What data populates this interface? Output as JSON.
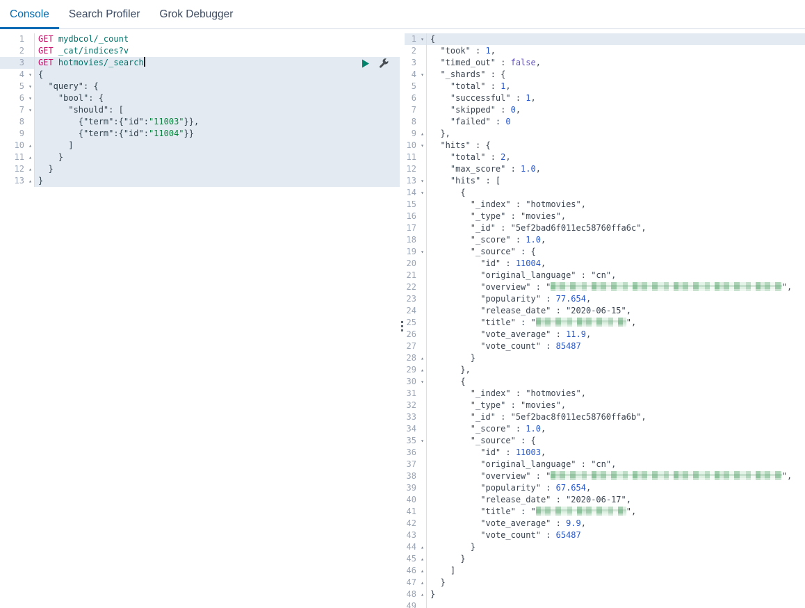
{
  "tabs": [
    {
      "label": "Console",
      "active": true
    },
    {
      "label": "Search Profiler",
      "active": false
    },
    {
      "label": "Grok Debugger",
      "active": false
    }
  ],
  "colors": {
    "accent_blue": "#006bb4",
    "method_pink": "#c80a68",
    "url_teal": "#00756b",
    "string_green": "#0a843f",
    "number_blue": "#2456c9",
    "boolean_violet": "#6554c0",
    "active_line_bg": "#e4eaf2",
    "play_icon_green": "#00826b"
  },
  "left_editor": {
    "lines": [
      {
        "n": 1,
        "f": "",
        "s": [
          [
            "m",
            "GET "
          ],
          [
            "u",
            "mydbcol/_count"
          ]
        ]
      },
      {
        "n": 2,
        "f": "",
        "s": [
          [
            "m",
            "GET "
          ],
          [
            "u",
            "_cat/indices?v"
          ]
        ]
      },
      {
        "n": 3,
        "f": "",
        "a": true,
        "icons": true,
        "s": [
          [
            "m",
            "GET "
          ],
          [
            "u",
            "hotmovies/_search"
          ],
          [
            "cur",
            ""
          ]
        ]
      },
      {
        "n": 4,
        "f": "o",
        "h": true,
        "s": [
          [
            "k",
            "{"
          ]
        ]
      },
      {
        "n": 5,
        "f": "o",
        "h": true,
        "s": [
          [
            "k",
            "  \"query\": {"
          ]
        ]
      },
      {
        "n": 6,
        "f": "o",
        "h": true,
        "s": [
          [
            "k",
            "    \"bool\": {"
          ]
        ]
      },
      {
        "n": 7,
        "f": "o",
        "h": true,
        "s": [
          [
            "k",
            "      \"should\": ["
          ]
        ]
      },
      {
        "n": 8,
        "f": "",
        "h": true,
        "s": [
          [
            "k",
            "        {\"term\":{\"id\":"
          ],
          [
            "s",
            "\"11003\""
          ],
          [
            "k",
            "}},"
          ]
        ]
      },
      {
        "n": 9,
        "f": "",
        "h": true,
        "s": [
          [
            "k",
            "        {\"term\":{\"id\":"
          ],
          [
            "s",
            "\"11004\""
          ],
          [
            "k",
            "}}"
          ]
        ]
      },
      {
        "n": 10,
        "f": "c",
        "h": true,
        "s": [
          [
            "k",
            "      ]"
          ]
        ]
      },
      {
        "n": 11,
        "f": "c",
        "h": true,
        "s": [
          [
            "k",
            "    }"
          ]
        ]
      },
      {
        "n": 12,
        "f": "c",
        "h": true,
        "s": [
          [
            "k",
            "  }"
          ]
        ]
      },
      {
        "n": 13,
        "f": "c",
        "h": true,
        "s": [
          [
            "k",
            "}"
          ]
        ]
      }
    ]
  },
  "right_editor": {
    "lines": [
      {
        "n": 1,
        "f": "o",
        "a": true,
        "s": [
          [
            "t",
            "{"
          ]
        ]
      },
      {
        "n": 2,
        "f": "",
        "s": [
          [
            "t",
            "  \"took\" : "
          ],
          [
            "n",
            "1"
          ],
          [
            "t",
            ","
          ]
        ]
      },
      {
        "n": 3,
        "f": "",
        "s": [
          [
            "t",
            "  \"timed_out\" : "
          ],
          [
            "b",
            "false"
          ],
          [
            "t",
            ","
          ]
        ]
      },
      {
        "n": 4,
        "f": "o",
        "s": [
          [
            "t",
            "  \"_shards\" : {"
          ]
        ]
      },
      {
        "n": 5,
        "f": "",
        "s": [
          [
            "t",
            "    \"total\" : "
          ],
          [
            "n",
            "1"
          ],
          [
            "t",
            ","
          ]
        ]
      },
      {
        "n": 6,
        "f": "",
        "s": [
          [
            "t",
            "    \"successful\" : "
          ],
          [
            "n",
            "1"
          ],
          [
            "t",
            ","
          ]
        ]
      },
      {
        "n": 7,
        "f": "",
        "s": [
          [
            "t",
            "    \"skipped\" : "
          ],
          [
            "n",
            "0"
          ],
          [
            "t",
            ","
          ]
        ]
      },
      {
        "n": 8,
        "f": "",
        "s": [
          [
            "t",
            "    \"failed\" : "
          ],
          [
            "n",
            "0"
          ]
        ]
      },
      {
        "n": 9,
        "f": "c",
        "s": [
          [
            "t",
            "  },"
          ]
        ]
      },
      {
        "n": 10,
        "f": "o",
        "s": [
          [
            "t",
            "  \"hits\" : {"
          ]
        ]
      },
      {
        "n": 11,
        "f": "",
        "s": [
          [
            "t",
            "    \"total\" : "
          ],
          [
            "n",
            "2"
          ],
          [
            "t",
            ","
          ]
        ]
      },
      {
        "n": 12,
        "f": "",
        "s": [
          [
            "t",
            "    \"max_score\" : "
          ],
          [
            "n",
            "1.0"
          ],
          [
            "t",
            ","
          ]
        ]
      },
      {
        "n": 13,
        "f": "o",
        "s": [
          [
            "t",
            "    \"hits\" : ["
          ]
        ]
      },
      {
        "n": 14,
        "f": "o",
        "s": [
          [
            "t",
            "      {"
          ]
        ]
      },
      {
        "n": 15,
        "f": "",
        "s": [
          [
            "t",
            "        \"_index\" : \"hotmovies\","
          ]
        ]
      },
      {
        "n": 16,
        "f": "",
        "s": [
          [
            "t",
            "        \"_type\" : \"movies\","
          ]
        ]
      },
      {
        "n": 17,
        "f": "",
        "s": [
          [
            "t",
            "        \"_id\" : \"5ef2bad6f011ec58760ffa6c\","
          ]
        ]
      },
      {
        "n": 18,
        "f": "",
        "s": [
          [
            "t",
            "        \"_score\" : "
          ],
          [
            "n",
            "1.0"
          ],
          [
            "t",
            ","
          ]
        ]
      },
      {
        "n": 19,
        "f": "o",
        "s": [
          [
            "t",
            "        \"_source\" : {"
          ]
        ]
      },
      {
        "n": 20,
        "f": "",
        "s": [
          [
            "t",
            "          \"id\" : "
          ],
          [
            "n",
            "11004"
          ],
          [
            "t",
            ","
          ]
        ]
      },
      {
        "n": 21,
        "f": "",
        "s": [
          [
            "t",
            "          \"original_language\" : \"cn\","
          ]
        ]
      },
      {
        "n": 22,
        "f": "",
        "s": [
          [
            "t",
            "          \"overview\" : \""
          ],
          [
            "c",
            "46"
          ],
          [
            "t",
            "\","
          ]
        ]
      },
      {
        "n": 23,
        "f": "",
        "s": [
          [
            "t",
            "          \"popularity\" : "
          ],
          [
            "n",
            "77.654"
          ],
          [
            "t",
            ","
          ]
        ]
      },
      {
        "n": 24,
        "f": "",
        "s": [
          [
            "t",
            "          \"release_date\" : \"2020-06-15\","
          ]
        ]
      },
      {
        "n": 25,
        "f": "",
        "s": [
          [
            "t",
            "          \"title\" : \""
          ],
          [
            "c",
            "18"
          ],
          [
            "t",
            "\","
          ]
        ]
      },
      {
        "n": 26,
        "f": "",
        "s": [
          [
            "t",
            "          \"vote_average\" : "
          ],
          [
            "n",
            "11.9"
          ],
          [
            "t",
            ","
          ]
        ]
      },
      {
        "n": 27,
        "f": "",
        "s": [
          [
            "t",
            "          \"vote_count\" : "
          ],
          [
            "n",
            "85487"
          ]
        ]
      },
      {
        "n": 28,
        "f": "c",
        "s": [
          [
            "t",
            "        }"
          ]
        ]
      },
      {
        "n": 29,
        "f": "c",
        "s": [
          [
            "t",
            "      },"
          ]
        ]
      },
      {
        "n": 30,
        "f": "o",
        "s": [
          [
            "t",
            "      {"
          ]
        ]
      },
      {
        "n": 31,
        "f": "",
        "s": [
          [
            "t",
            "        \"_index\" : \"hotmovies\","
          ]
        ]
      },
      {
        "n": 32,
        "f": "",
        "s": [
          [
            "t",
            "        \"_type\" : \"movies\","
          ]
        ]
      },
      {
        "n": 33,
        "f": "",
        "s": [
          [
            "t",
            "        \"_id\" : \"5ef2bac8f011ec58760ffa6b\","
          ]
        ]
      },
      {
        "n": 34,
        "f": "",
        "s": [
          [
            "t",
            "        \"_score\" : "
          ],
          [
            "n",
            "1.0"
          ],
          [
            "t",
            ","
          ]
        ]
      },
      {
        "n": 35,
        "f": "o",
        "s": [
          [
            "t",
            "        \"_source\" : {"
          ]
        ]
      },
      {
        "n": 36,
        "f": "",
        "s": [
          [
            "t",
            "          \"id\" : "
          ],
          [
            "n",
            "11003"
          ],
          [
            "t",
            ","
          ]
        ]
      },
      {
        "n": 37,
        "f": "",
        "s": [
          [
            "t",
            "          \"original_language\" : \"cn\","
          ]
        ]
      },
      {
        "n": 38,
        "f": "",
        "s": [
          [
            "t",
            "          \"overview\" : \""
          ],
          [
            "c",
            "46"
          ],
          [
            "t",
            "\","
          ]
        ]
      },
      {
        "n": 39,
        "f": "",
        "s": [
          [
            "t",
            "          \"popularity\" : "
          ],
          [
            "n",
            "67.654"
          ],
          [
            "t",
            ","
          ]
        ]
      },
      {
        "n": 40,
        "f": "",
        "s": [
          [
            "t",
            "          \"release_date\" : \"2020-06-17\","
          ]
        ]
      },
      {
        "n": 41,
        "f": "",
        "s": [
          [
            "t",
            "          \"title\" : \""
          ],
          [
            "c",
            "18"
          ],
          [
            "t",
            "\","
          ]
        ]
      },
      {
        "n": 42,
        "f": "",
        "s": [
          [
            "t",
            "          \"vote_average\" : "
          ],
          [
            "n",
            "9.9"
          ],
          [
            "t",
            ","
          ]
        ]
      },
      {
        "n": 43,
        "f": "",
        "s": [
          [
            "t",
            "          \"vote_count\" : "
          ],
          [
            "n",
            "65487"
          ]
        ]
      },
      {
        "n": 44,
        "f": "c",
        "s": [
          [
            "t",
            "        }"
          ]
        ]
      },
      {
        "n": 45,
        "f": "c",
        "s": [
          [
            "t",
            "      }"
          ]
        ]
      },
      {
        "n": 46,
        "f": "c",
        "s": [
          [
            "t",
            "    ]"
          ]
        ]
      },
      {
        "n": 47,
        "f": "c",
        "s": [
          [
            "t",
            "  }"
          ]
        ]
      },
      {
        "n": 48,
        "f": "c",
        "s": [
          [
            "t",
            "}"
          ]
        ]
      },
      {
        "n": 49,
        "f": "",
        "s": []
      }
    ]
  }
}
